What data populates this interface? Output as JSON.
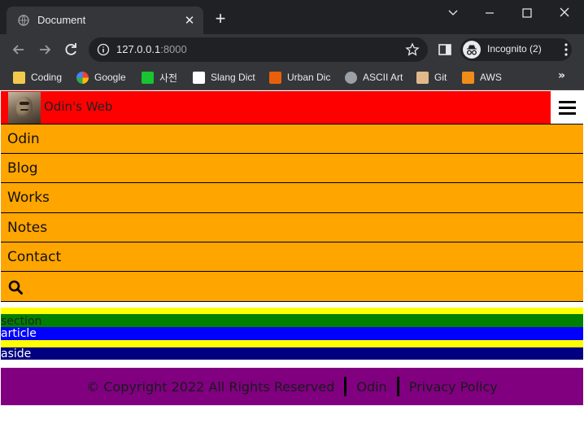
{
  "browser": {
    "tab_title": "Document",
    "url_host": "127.0.0.1",
    "url_port": ":8000",
    "profile_label": "Incognito (2)",
    "bookmarks": [
      {
        "label": "Coding",
        "icon": "folder-icon",
        "color": "#f2c94c"
      },
      {
        "label": "Google",
        "icon": "google-icon",
        "color": "#4285f4"
      },
      {
        "label": "사전",
        "icon": "dictionary-icon",
        "color": "#19c332"
      },
      {
        "label": "Slang Dict",
        "icon": "slang-dict-icon",
        "color": "#ffffff"
      },
      {
        "label": "Urban Dic",
        "icon": "urban-dic-icon",
        "color": "#e8600b"
      },
      {
        "label": "ASCII Art",
        "icon": "globe-icon",
        "color": "#9aa0a6"
      },
      {
        "label": "Git",
        "icon": "git-icon",
        "color": "#e0b88a"
      },
      {
        "label": "AWS",
        "icon": "aws-icon",
        "color": "#f08c1a"
      }
    ]
  },
  "site": {
    "title": "Odin's Web",
    "header_color": "#ff0000",
    "nav_color": "#ffa500",
    "nav": [
      "Odin",
      "Blog",
      "Works",
      "Notes",
      "Contact"
    ],
    "sections": {
      "section_label": "section",
      "article_label": "article",
      "aside_label": "aside"
    },
    "footer": {
      "copyright": "© Copyright 2022 All Rights Reserved",
      "link_odin": "Odin",
      "link_privacy": "Privacy Policy",
      "color": "#800080"
    }
  }
}
